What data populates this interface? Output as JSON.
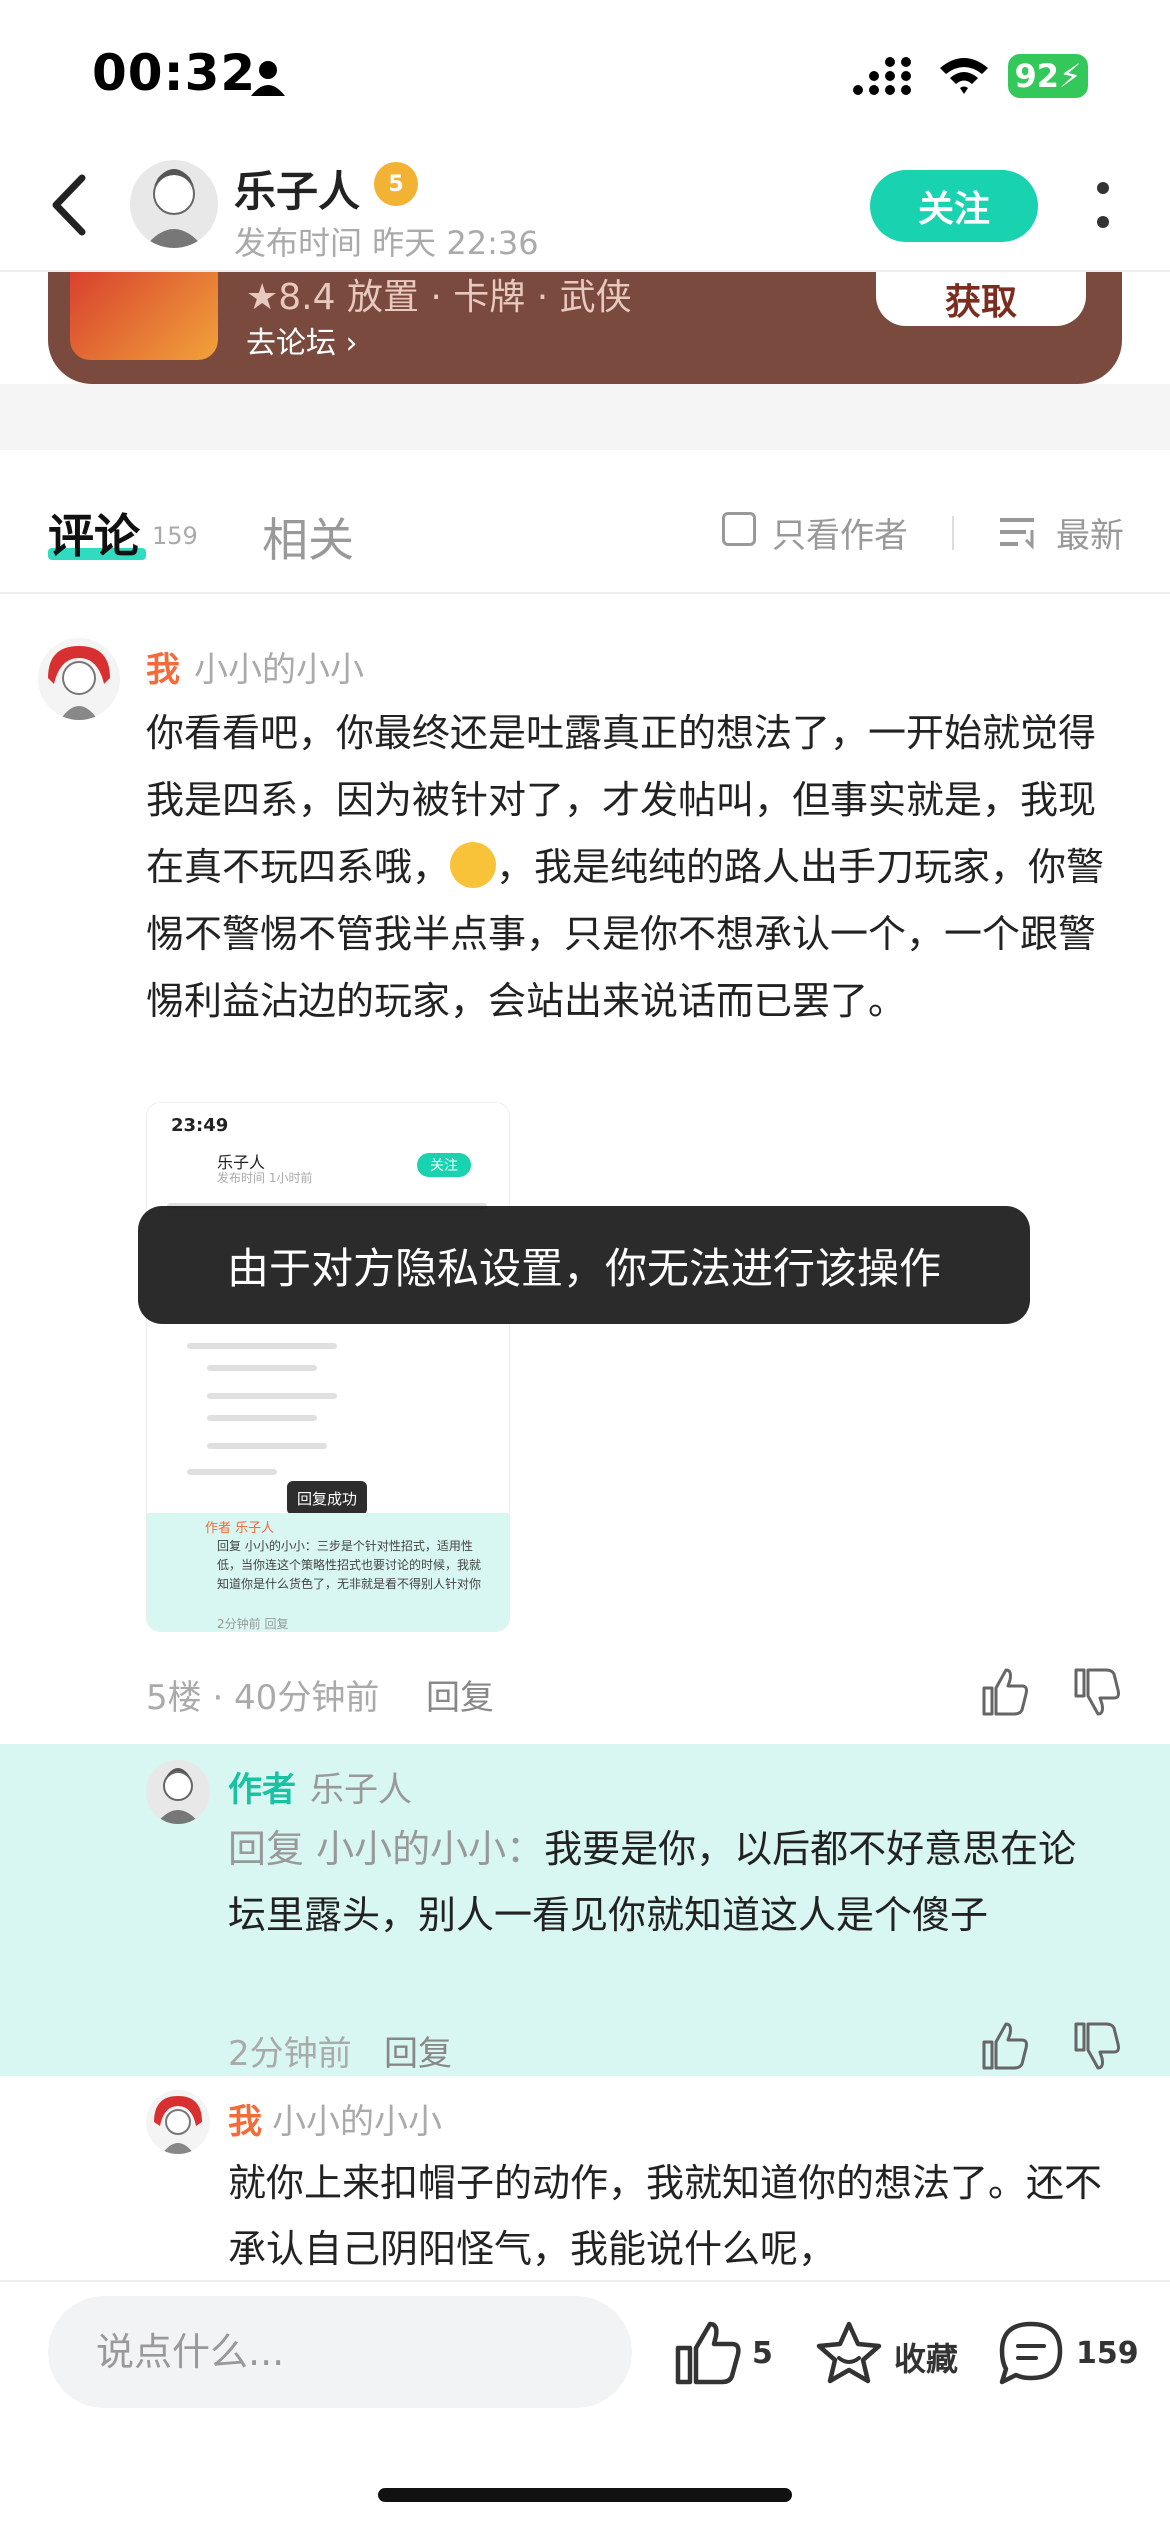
{
  "status_bar": {
    "time": "00:32",
    "battery": "92"
  },
  "header": {
    "author_name": "乐子人",
    "level_badge": "5",
    "publish_time": "发布时间 昨天 22:36",
    "follow_label": "关注"
  },
  "game_card": {
    "rating": "★8.4 放置 · 卡牌 · 武侠",
    "forum_link": "去论坛 ›",
    "get_label": "获取"
  },
  "tabs": {
    "comments_label": "评论",
    "comments_count": "159",
    "related_label": "相关",
    "only_author_label": "只看作者",
    "sort_label": "最新"
  },
  "comment": {
    "me_tag": "我",
    "username": "小小的小小",
    "text_before_emoji": "你看看吧，你最终还是吐露真正的想法了，一开始就觉得我是四系，因为被针对了，才发帖叫，但事实就是，我现在真不玩四系哦，",
    "text_after_emoji": "，我是纯纯的路人出手刀玩家，你警惕不警惕不管我半点事，只是你不想承认一个，一个跟警惕利益沾边的玩家，会站出来说话而已罢了。",
    "emoji": "smiling-emoji",
    "meta": "5楼 · 40分钟前",
    "reply_label": "回复",
    "screenshot": {
      "time": "23:49",
      "name": "乐子人",
      "sub": "发布时间 1小时前",
      "follow": "关注",
      "toast": "回复成功",
      "author_tag": "作者 乐子人",
      "author_text": "回复 小小的小小：三步是个针对性招式，适用性低，当你连这个策略性招式也要讨论的时候，我就知道你是什么货色了，无非就是看不得别人针对你",
      "footer": "2分钟前 回复"
    }
  },
  "toast": {
    "text": "由于对方隐私设置，你无法进行该操作"
  },
  "reply1": {
    "author_tag": "作者",
    "username": "乐子人",
    "prefix": "回复 小小的小小：",
    "text": "我要是你，以后都不好意思在论坛里露头，别人一看见你就知道这人是个傻子",
    "meta": "2分钟前",
    "reply_label": "回复"
  },
  "reply2": {
    "me_tag": "我",
    "username": "小小的小小",
    "text": "就你上来扣帽子的动作，我就知道你的想法了。还不承认自己阴阳怪气，我能说什么呢，"
  },
  "bottom_bar": {
    "input_placeholder": "说点什么...",
    "like_count": "5",
    "favorite_label": "收藏",
    "comment_count": "159"
  },
  "colors": {
    "accent": "#19d2b0",
    "me_tag": "#f26b3a",
    "game_card": "#7b4a3e",
    "reply_highlight": "#d8f6f2"
  }
}
